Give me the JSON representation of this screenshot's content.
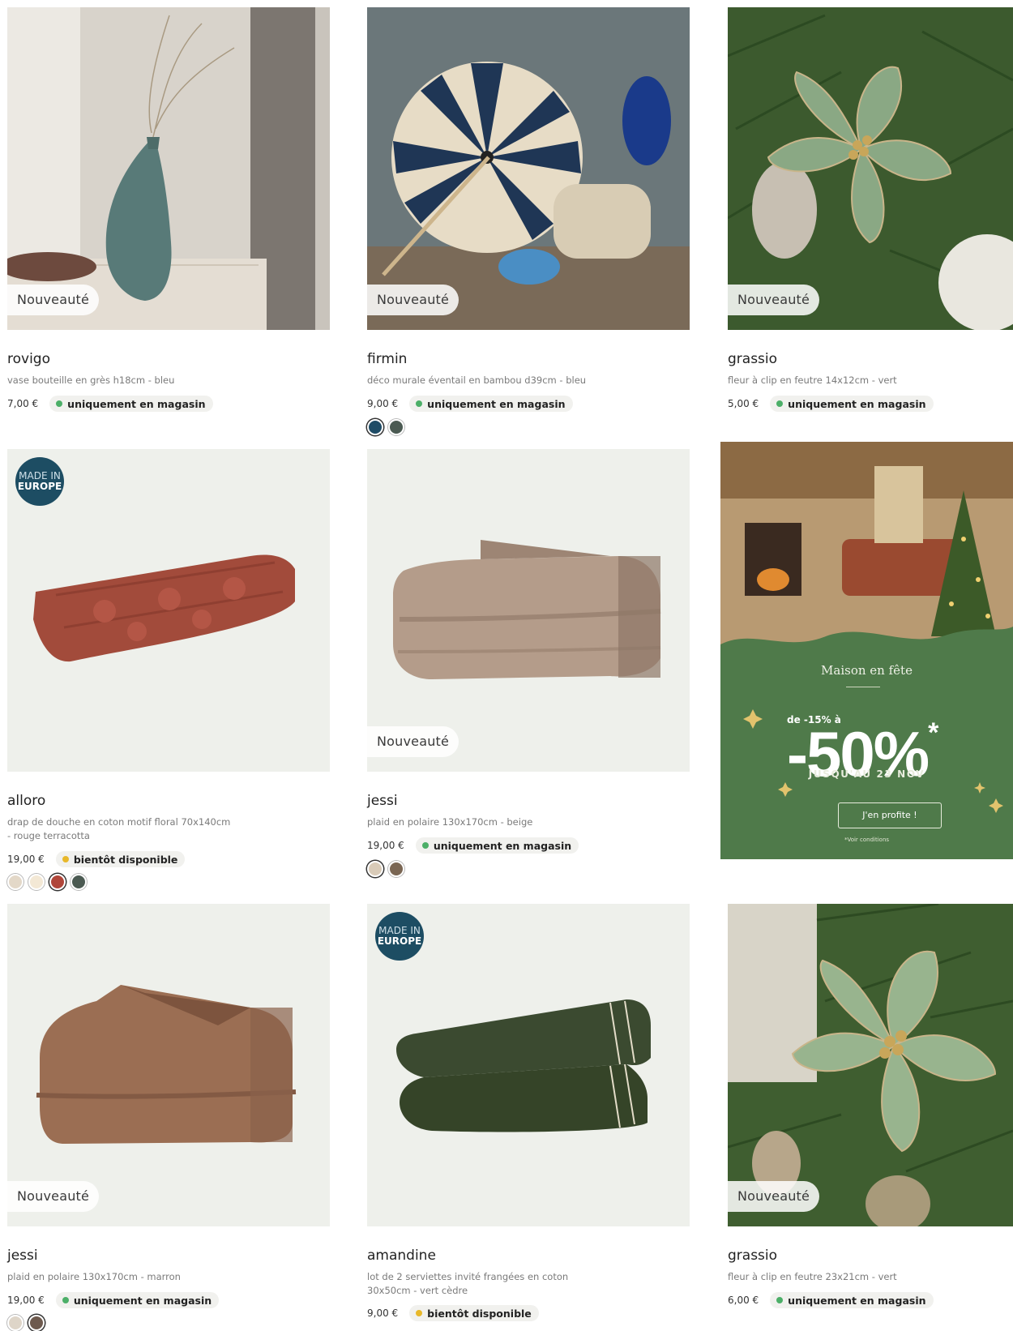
{
  "labels": {
    "new": "Nouveauté",
    "made_line1": "MADE IN",
    "made_line2": "EUROPE"
  },
  "colors": {
    "in_store": "#4caf68",
    "soon": "#e8b82a"
  },
  "products": [
    {
      "name": "rovigo",
      "desc": "vase bouteille en grès h18cm - bleu",
      "price": "7,00 €",
      "availability": "uniquement en magasin"
    },
    {
      "name": "firmin",
      "desc": "déco murale éventail en bambou d39cm - bleu",
      "price": "9,00 €",
      "availability": "uniquement en magasin",
      "swatches": [
        "#1f4c66",
        "#4b5a52"
      ]
    },
    {
      "name": "grassio",
      "desc": "fleur à clip en feutre 14x12cm - vert",
      "price": "5,00 €",
      "availability": "uniquement en magasin"
    },
    {
      "name": "alloro",
      "desc": "drap de douche en coton motif floral 70x140cm - rouge terracotta",
      "price": "19,00 €",
      "availability": "bientôt disponible",
      "swatches": [
        "#e3d8c8",
        "#f3e8d5",
        "#b0463a",
        "#4b5a52"
      ]
    },
    {
      "name": "jessi",
      "desc": "plaid en polaire 130x170cm - beige",
      "price": "19,00 €",
      "availability": "uniquement en magasin",
      "swatches": [
        "#d9cbb8",
        "#7a6653"
      ]
    },
    {
      "name": "jessi",
      "desc": "plaid en polaire 130x170cm - marron",
      "price": "19,00 €",
      "availability": "uniquement en magasin",
      "swatches": [
        "#ded5c8",
        "#6e5a4e"
      ]
    },
    {
      "name": "amandine",
      "desc": "lot de 2 serviettes invité frangées en coton 30x50cm - vert cèdre",
      "price": "9,00 €",
      "availability": "bientôt disponible"
    },
    {
      "name": "grassio",
      "desc": "fleur à clip en feutre 23x21cm - vert",
      "price": "6,00 €",
      "availability": "uniquement en magasin"
    }
  ],
  "promo": {
    "title": "Maison en fête",
    "prefix": "de -15% à",
    "big": "-50%",
    "star": "*",
    "until": "JUSQU'AU 23 NOV",
    "button": "J'en profite !",
    "conditions": "*Voir conditions"
  }
}
